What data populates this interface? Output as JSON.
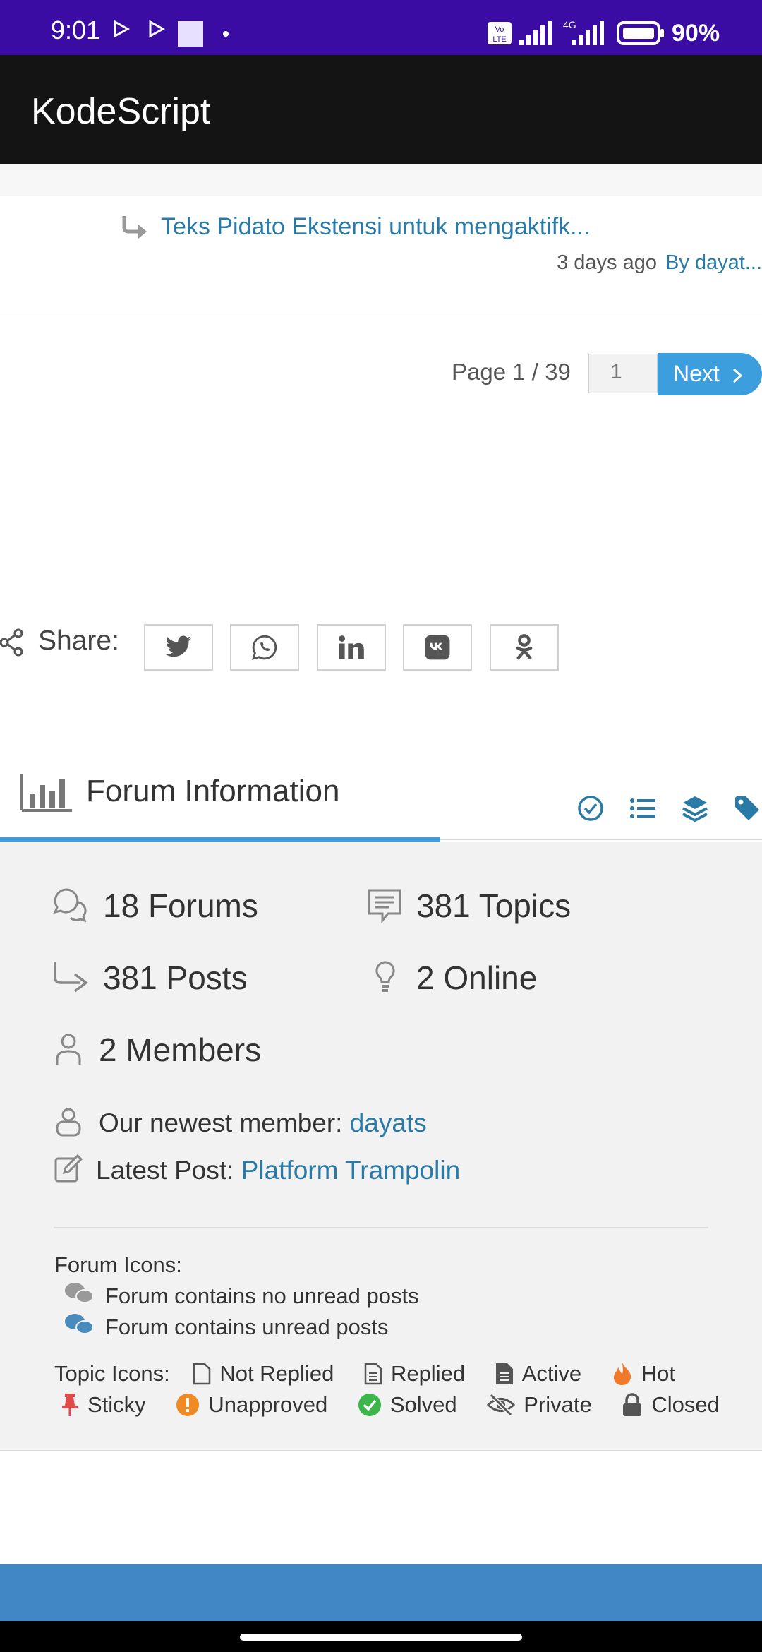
{
  "status_bar": {
    "time": "9:01",
    "battery": "90%"
  },
  "app_bar": {
    "title": "KodeScript"
  },
  "topic": {
    "link": "Teks Pidato Ekstensi untuk mengaktifk...",
    "ago": "3 days ago",
    "by": "By dayat..."
  },
  "pagination": {
    "page_info": "Page 1 / 39",
    "page_input": "1",
    "next_label": "Next"
  },
  "share": {
    "label": "Share:",
    "buttons": [
      "twitter-icon",
      "whatsapp-icon",
      "linkedin-icon",
      "vk-icon",
      "odnoklassniki-icon"
    ]
  },
  "forum_info": {
    "title": "Forum Information",
    "tabs": [
      "check-circle-icon",
      "list-icon",
      "layers-icon",
      "tag-icon"
    ],
    "stats": {
      "forums": "18 Forums",
      "topics": "381 Topics",
      "posts": "381 Posts",
      "online": "2 Online",
      "members": "2 Members"
    },
    "newest_member_label": "Our newest member:",
    "newest_member": "dayats",
    "latest_post_label": "Latest Post:",
    "latest_post": "Platform Trampolin",
    "forum_icons_label": "Forum Icons:",
    "forum_no_unread": "Forum contains no unread posts",
    "forum_unread": "Forum contains unread posts",
    "topic_icons_label": "Topic Icons:",
    "topic_icons": {
      "not_replied": "Not Replied",
      "replied": "Replied",
      "active": "Active",
      "hot": "Hot",
      "sticky": "Sticky",
      "unapproved": "Unapproved",
      "solved": "Solved",
      "private": "Private",
      "closed": "Closed"
    }
  },
  "colors": {
    "status_bar": "#3a0ca3",
    "app_bar": "#141414",
    "accent": "#3d9ede",
    "link": "#2a7aa8",
    "bottom_bar": "#4187c5"
  }
}
